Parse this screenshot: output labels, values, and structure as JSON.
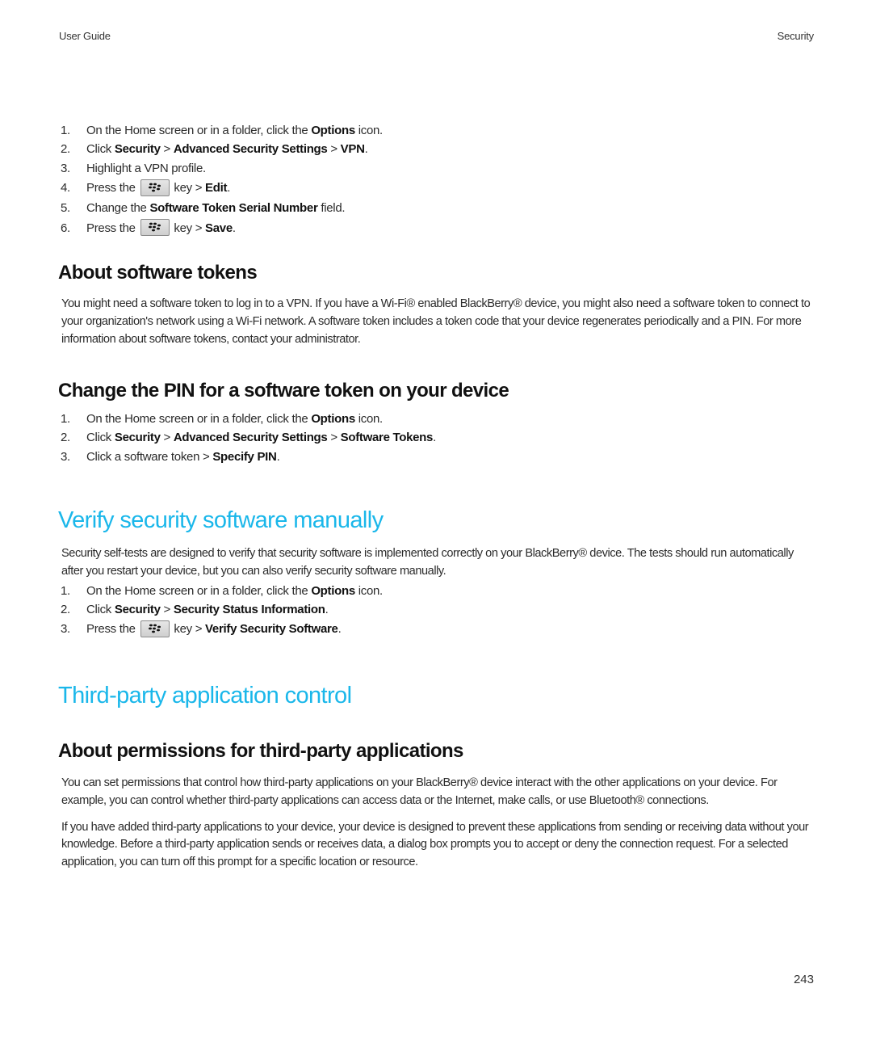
{
  "header": {
    "left": "User Guide",
    "right": "Security"
  },
  "vpn_steps": [
    {
      "num": "1.",
      "parts": [
        {
          "t": "On the Home screen or in a folder, click the "
        },
        {
          "b": "Options"
        },
        {
          "t": " icon."
        }
      ]
    },
    {
      "num": "2.",
      "parts": [
        {
          "t": "Click "
        },
        {
          "b": "Security"
        },
        {
          "t": " > "
        },
        {
          "b": "Advanced Security Settings"
        },
        {
          "t": " > "
        },
        {
          "b": "VPN"
        },
        {
          "t": "."
        }
      ]
    },
    {
      "num": "3.",
      "parts": [
        {
          "t": "Highlight a VPN profile."
        }
      ]
    },
    {
      "num": "4.",
      "parts": [
        {
          "t": "Press the "
        },
        {
          "key": "blackberry-menu-key"
        },
        {
          "t": " key > "
        },
        {
          "b": "Edit"
        },
        {
          "t": "."
        }
      ]
    },
    {
      "num": "5.",
      "parts": [
        {
          "t": "Change the "
        },
        {
          "b": "Software Token Serial Number"
        },
        {
          "t": " field."
        }
      ]
    },
    {
      "num": "6.",
      "parts": [
        {
          "t": "Press the "
        },
        {
          "key": "blackberry-menu-key"
        },
        {
          "t": " key > "
        },
        {
          "b": "Save"
        },
        {
          "t": "."
        }
      ]
    }
  ],
  "about_tokens": {
    "heading": "About software tokens",
    "body": "You might need a software token to log in to a VPN. If you have a Wi-Fi® enabled BlackBerry® device, you might also need a software token to connect to your organization's network using a Wi-Fi network. A software token includes a token code that your device regenerates periodically and a PIN. For more information about software tokens, contact your administrator."
  },
  "change_pin": {
    "heading": "Change the PIN for a software token on your device",
    "steps": [
      {
        "num": "1.",
        "parts": [
          {
            "t": "On the Home screen or in a folder, click the "
          },
          {
            "b": "Options"
          },
          {
            "t": " icon."
          }
        ]
      },
      {
        "num": "2.",
        "parts": [
          {
            "t": "Click "
          },
          {
            "b": "Security"
          },
          {
            "t": " > "
          },
          {
            "b": "Advanced Security Settings"
          },
          {
            "t": " > "
          },
          {
            "b": "Software Tokens"
          },
          {
            "t": "."
          }
        ]
      },
      {
        "num": "3.",
        "parts": [
          {
            "t": "Click a software token > "
          },
          {
            "b": "Specify PIN"
          },
          {
            "t": "."
          }
        ]
      }
    ]
  },
  "verify": {
    "heading": "Verify security software manually",
    "body": "Security self-tests are designed to verify that security software is implemented correctly on your BlackBerry® device. The tests should run automatically after you restart your device, but you can also verify security software manually.",
    "steps": [
      {
        "num": "1.",
        "parts": [
          {
            "t": "On the Home screen or in a folder, click the "
          },
          {
            "b": "Options"
          },
          {
            "t": " icon."
          }
        ]
      },
      {
        "num": "2.",
        "parts": [
          {
            "t": "Click "
          },
          {
            "b": "Security"
          },
          {
            "t": " > "
          },
          {
            "b": "Security Status Information"
          },
          {
            "t": "."
          }
        ]
      },
      {
        "num": "3.",
        "parts": [
          {
            "t": "Press the "
          },
          {
            "key": "blackberry-menu-key"
          },
          {
            "t": " key > "
          },
          {
            "b": "Verify Security Software"
          },
          {
            "t": "."
          }
        ]
      }
    ]
  },
  "third_party": {
    "heading": "Third-party application control",
    "subheading": "About permissions for third-party applications",
    "body1": "You can set permissions that control how third-party applications on your BlackBerry® device interact with the other applications on your device. For example, you can control whether third-party applications can access data or the Internet, make calls, or use Bluetooth® connections.",
    "body2": "If you have added third-party applications to your device, your device is designed to prevent these applications from sending or receiving data without your knowledge. Before a third-party application sends or receives data, a dialog box prompts you to accept or deny the connection request. For a selected application, you can turn off this prompt for a specific location or resource."
  },
  "page_number": "243",
  "colors": {
    "heading_accent": "#1ab7ea",
    "text": "#2b2b2b"
  }
}
